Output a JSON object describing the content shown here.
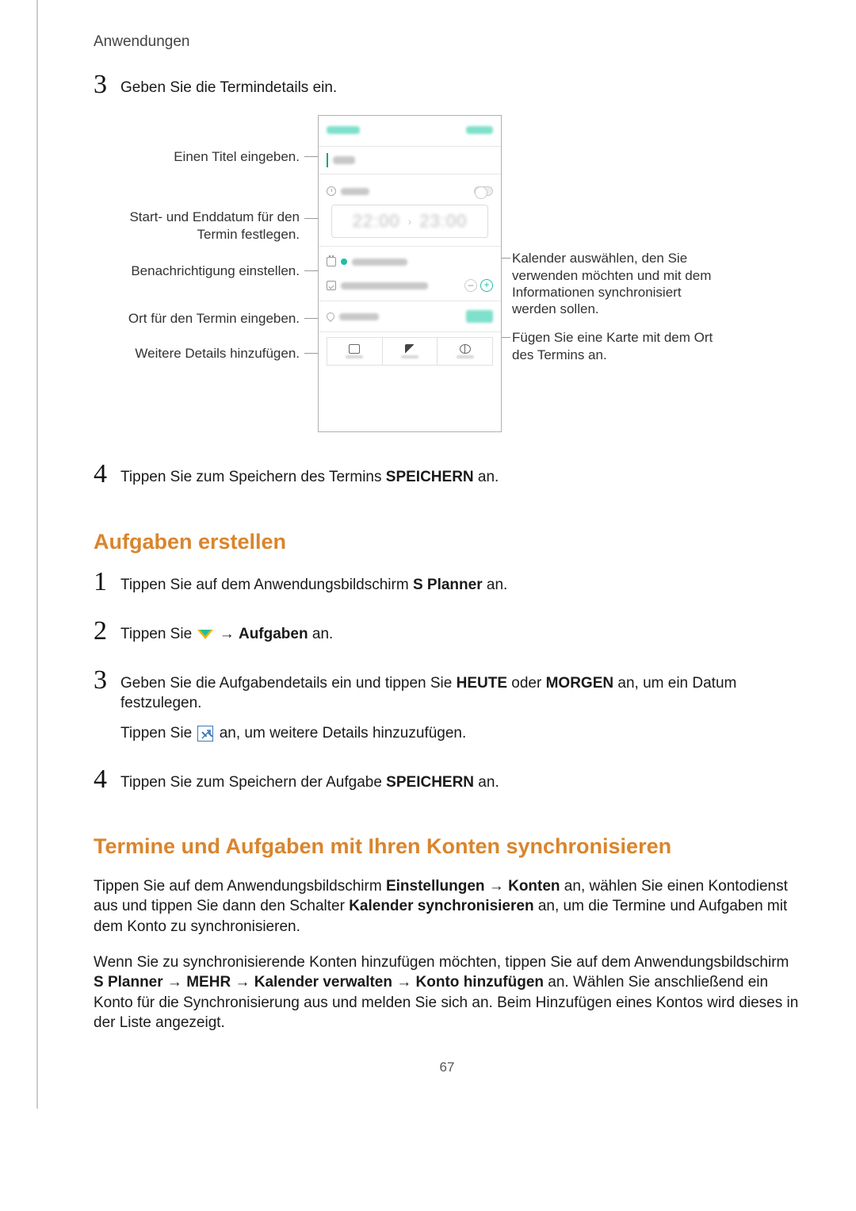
{
  "header": {
    "breadcrumb": "Anwendungen"
  },
  "section1": {
    "step3": {
      "num": "3",
      "text": "Geben Sie die Termindetails ein."
    },
    "step4": {
      "num": "4",
      "text_pre": "Tippen Sie zum Speichern des Termins ",
      "bold": "SPEICHERN",
      "text_post": " an."
    }
  },
  "figure": {
    "callouts_left": {
      "title": "Einen Titel eingeben.",
      "dates": "Start- und Enddatum für den Termin festlegen.",
      "notify": "Benachrichtigung einstellen.",
      "place": "Ort für den Termin eingeben.",
      "more": "Weitere Details hinzufügen."
    },
    "callouts_right": {
      "calendar": "Kalender auswählen, den Sie verwenden möchten und mit dem Informationen synchronisiert werden sollen.",
      "map": "Fügen Sie eine Karte mit dem Ort des Termins an."
    },
    "phone": {
      "time_start": "22:00",
      "time_end": "23:00"
    }
  },
  "section2": {
    "heading": "Aufgaben erstellen",
    "step1": {
      "num": "1",
      "pre": "Tippen Sie auf dem Anwendungsbildschirm ",
      "bold": "S Planner",
      "post": " an."
    },
    "step2": {
      "num": "2",
      "pre": "Tippen Sie ",
      "arrow": "→",
      "bold": "Aufgaben",
      "post": " an."
    },
    "step3": {
      "num": "3",
      "line1_pre": "Geben Sie die Aufgabendetails ein und tippen Sie ",
      "line1_b1": "HEUTE",
      "line1_mid": " oder ",
      "line1_b2": "MORGEN",
      "line1_post": " an, um ein Datum festzulegen.",
      "line2_pre": "Tippen Sie ",
      "line2_post": " an, um weitere Details hinzuzufügen."
    },
    "step4": {
      "num": "4",
      "pre": "Tippen Sie zum Speichern der Aufgabe ",
      "bold": "SPEICHERN",
      "post": " an."
    }
  },
  "section3": {
    "heading": "Termine und Aufgaben mit Ihren Konten synchronisieren",
    "para1_pre": "Tippen Sie auf dem Anwendungsbildschirm ",
    "para1_b1": "Einstellungen",
    "para1_arrow": " → ",
    "para1_b2": "Konten",
    "para1_mid": " an, wählen Sie einen Kontodienst aus und tippen Sie dann den Schalter ",
    "para1_b3": "Kalender synchronisieren",
    "para1_post": " an, um die Termine und Aufgaben mit dem Konto zu synchronisieren.",
    "para2_pre": "Wenn Sie zu synchronisierende Konten hinzufügen möchten, tippen Sie auf dem Anwendungsbildschirm ",
    "para2_b1": "S Planner",
    "para2_b2": "MEHR",
    "para2_b3": "Kalender verwalten",
    "para2_b4": "Konto hinzufügen",
    "para2_post": " an. Wählen Sie anschließend ein Konto für die Synchronisierung aus und melden Sie sich an. Beim Hinzufügen eines Kontos wird dieses in der Liste angezeigt."
  },
  "page_number": "67"
}
